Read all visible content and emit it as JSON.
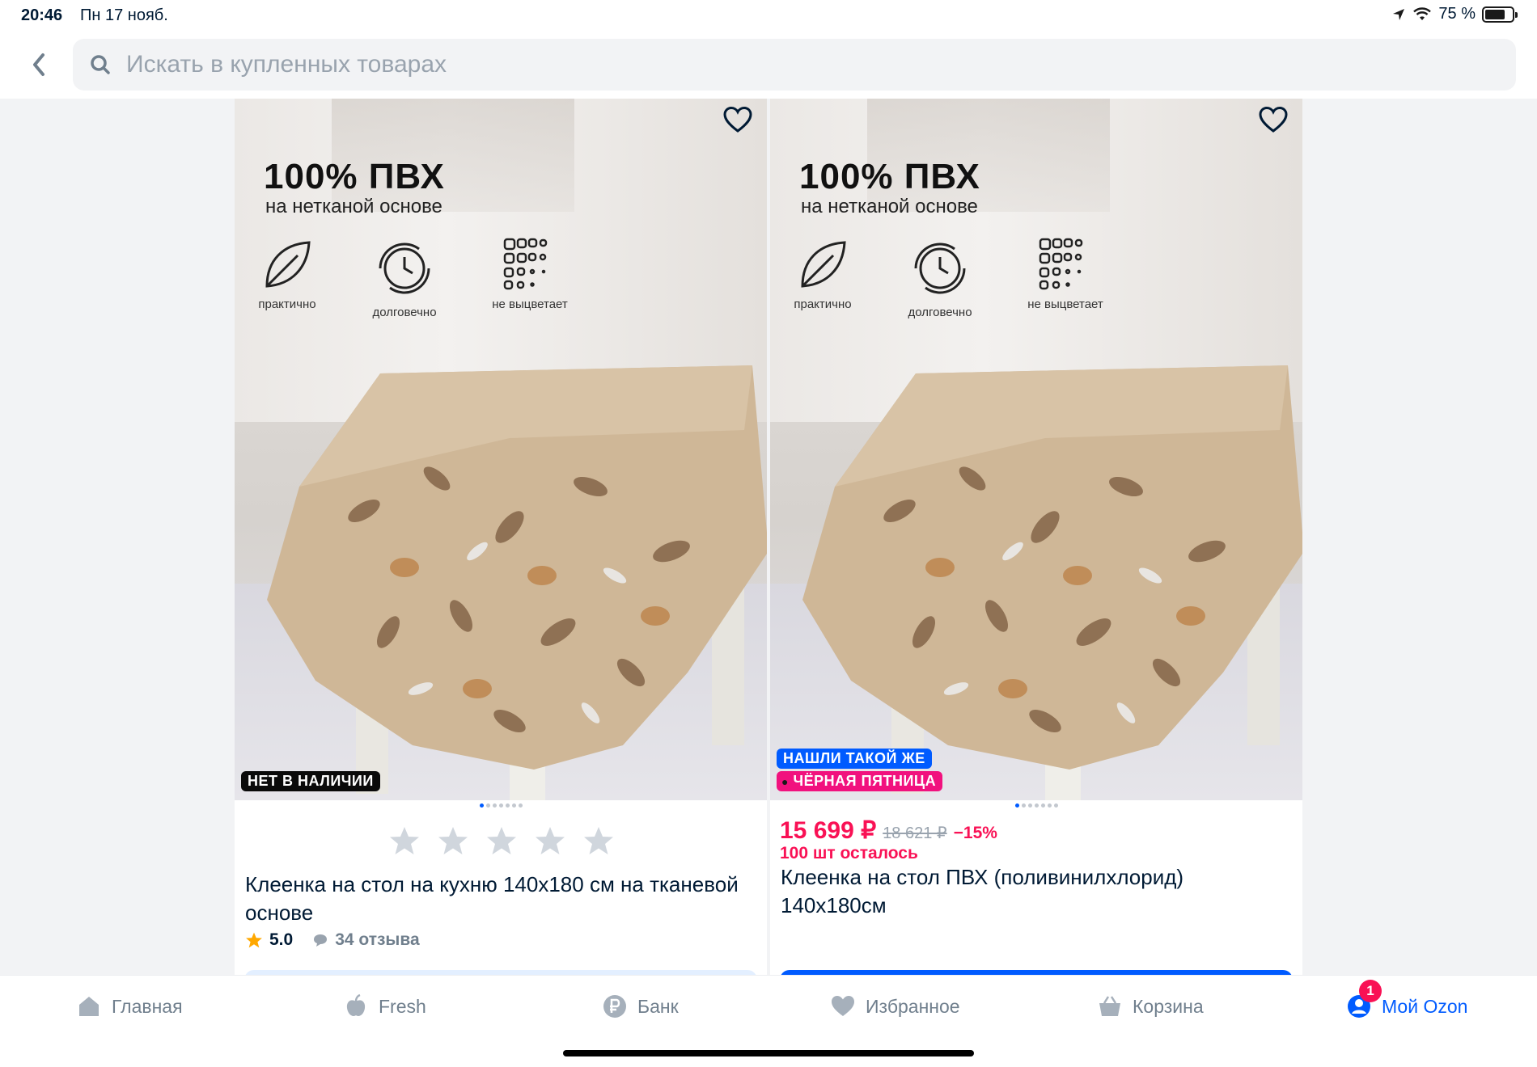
{
  "status": {
    "time": "20:46",
    "date": "Пн 17 нояб.",
    "battery": "75 %",
    "battery_level": 0.75
  },
  "search": {
    "placeholder": "Искать в купленных товарах"
  },
  "products": [
    {
      "promo_title": "100% ПВХ",
      "promo_sub": "на нетканой основе",
      "features": [
        "практично",
        "долговечно",
        "не выцветает"
      ],
      "badges": [
        "НЕТ В НАЛИЧИИ"
      ],
      "title": "Клеенка на стол на кухню 140x180 см на тканевой основе",
      "rating": "5.0",
      "reviews": "34 отзыва",
      "stars": 5
    },
    {
      "promo_title": "100% ПВХ",
      "promo_sub": "на нетканой основе",
      "features": [
        "практично",
        "долговечно",
        "не выцветает"
      ],
      "badges": [
        "НАШЛИ ТАКОЙ ЖЕ",
        "ЧЁРНАЯ ПЯТНИЦА"
      ],
      "price": "15 699 ₽",
      "old_price": "18 621 ₽",
      "discount": "−15%",
      "stock": "100 шт осталось",
      "title": "Клеенка на стол ПВХ (поливинилхлорид) 140x180см"
    }
  ],
  "tabbar": {
    "items": [
      "Главная",
      "Fresh",
      "Банк",
      "Избранное",
      "Корзина",
      "Мой Ozon"
    ],
    "notification": "1"
  },
  "colors": {
    "accent": "#005bff",
    "price": "#f91155",
    "muted": "#707f8d"
  }
}
